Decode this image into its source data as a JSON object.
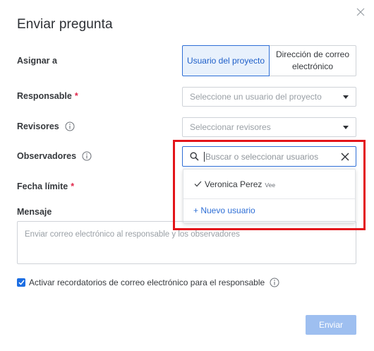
{
  "dialog": {
    "title": "Enviar pregunta"
  },
  "assign": {
    "label": "Asignar a",
    "options": [
      {
        "label": "Usuario del proyecto",
        "selected": true
      },
      {
        "label": "Dirección de correo electrónico",
        "selected": false
      }
    ]
  },
  "responsable": {
    "label": "Responsable",
    "required_mark": "*",
    "placeholder": "Seleccione un usuario del proyecto"
  },
  "revisores": {
    "label": "Revisores",
    "placeholder": "Seleccionar revisores"
  },
  "observadores": {
    "label": "Observadores",
    "search_placeholder": "Buscar o seleccionar usuarios",
    "dropdown": {
      "selected_user": "Veronica Perez",
      "selected_user_tag": "Vee",
      "new_user_label": "+ Nuevo usuario"
    }
  },
  "fecha_limite": {
    "label": "Fecha límite",
    "required_mark": "*"
  },
  "mensaje": {
    "label": "Mensaje",
    "placeholder": "Enviar correo electrónico al responsable y los observadores"
  },
  "reminder": {
    "label": "Activar recordatorios de correo electrónico para el responsable",
    "checked": true
  },
  "actions": {
    "submit_label": "Enviar"
  },
  "colors": {
    "accent": "#2f6fd6",
    "required": "#e0284b",
    "highlight": "#e3151a",
    "submit_disabled": "#9ebff0"
  }
}
